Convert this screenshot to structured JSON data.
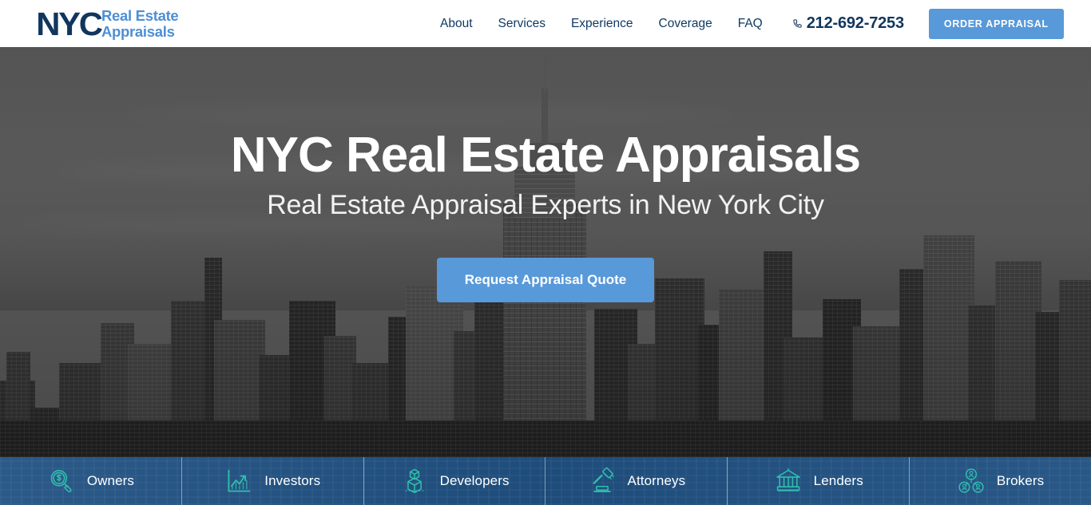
{
  "header": {
    "logo": {
      "nyc": "NYC",
      "line1": "Real Estate",
      "line2": "Appraisals"
    },
    "nav": [
      {
        "label": "About"
      },
      {
        "label": "Services"
      },
      {
        "label": "Experience"
      },
      {
        "label": "Coverage"
      },
      {
        "label": "FAQ"
      }
    ],
    "phone": {
      "number": "212-692-7253",
      "icon": "phone-icon"
    },
    "cta": {
      "label": "ORDER APPRAISAL"
    }
  },
  "hero": {
    "title": "NYC Real Estate Appraisals",
    "subtitle": "Real Estate Appraisal Experts in New York City",
    "cta": {
      "label": "Request Appraisal Quote"
    }
  },
  "service_bar": {
    "items": [
      {
        "label": "Owners",
        "icon": "magnifier-dollar-icon"
      },
      {
        "label": "Investors",
        "icon": "growth-chart-icon"
      },
      {
        "label": "Developers",
        "icon": "cube-box-icon"
      },
      {
        "label": "Attorneys",
        "icon": "gavel-icon"
      },
      {
        "label": "Lenders",
        "icon": "bank-icon"
      },
      {
        "label": "Brokers",
        "icon": "people-network-icon"
      }
    ]
  },
  "colors": {
    "brand_navy": "#11365e",
    "brand_blue": "#4d8fd6",
    "accent_blue": "#5899da",
    "bar_blue": "#205182",
    "icon_teal": "#2fbfae",
    "white": "#ffffff"
  }
}
